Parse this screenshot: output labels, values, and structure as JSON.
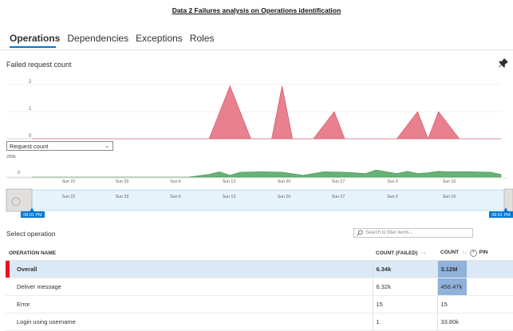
{
  "document": {
    "title": "Data 2 Failures analysis on Operations identification"
  },
  "tabs": [
    {
      "label": "Operations",
      "active": true
    },
    {
      "label": "Dependencies"
    },
    {
      "label": "Exceptions"
    },
    {
      "label": "Roles"
    }
  ],
  "failed_chart": {
    "title": "Failed request count",
    "pin_icon": "pin-icon"
  },
  "metric_select": {
    "value": "Request count"
  },
  "chart_data": [
    {
      "type": "area",
      "title": "Failed request count",
      "ylim": [
        0,
        2
      ],
      "yticks": [
        "2",
        "1",
        "0"
      ],
      "x_day_index": [
        0,
        17,
        19,
        21,
        23,
        24,
        25,
        27,
        29,
        30,
        31,
        35,
        37,
        38,
        39,
        41,
        43,
        45
      ],
      "values": [
        0,
        0,
        1.95,
        0,
        0,
        1.95,
        0,
        0,
        1.0,
        0,
        0,
        0,
        1.0,
        0,
        1.0,
        0,
        0,
        0
      ],
      "xlim_days": [
        0,
        45
      ],
      "color": "#e8808e"
    },
    {
      "type": "area",
      "title": "Request count",
      "yticks": [
        "200k",
        "0"
      ],
      "ylim": [
        0,
        200
      ],
      "x_day_index": [
        0,
        3,
        6,
        9,
        12,
        15,
        17,
        18,
        19,
        20,
        22,
        24,
        26,
        28,
        30,
        32,
        33,
        35,
        36,
        37,
        38,
        39,
        40,
        42,
        44,
        45
      ],
      "values": [
        0,
        0,
        0,
        0,
        0,
        0,
        30,
        60,
        20,
        55,
        60,
        55,
        20,
        60,
        55,
        40,
        80,
        40,
        65,
        40,
        50,
        65,
        60,
        60,
        55,
        30
      ],
      "color": "#66b376",
      "xtick_labels": [
        "Sun 22",
        "Sun 29",
        "Sun 6",
        "Sun 13",
        "Sun 20",
        "Sun 27",
        "Sun 3",
        "Sun 10"
      ]
    }
  ],
  "time_brush": {
    "left_label": "08:01 PM",
    "right_label": "08:01 PM"
  },
  "operations": {
    "title": "Select operation",
    "filter_placeholder": "Search to filter items...",
    "columns": {
      "name": "OPERATION NAME",
      "failed": "COUNT (FAILED)",
      "count": "COUNT",
      "pin": "PIN"
    },
    "rows": [
      {
        "name": "Overall",
        "failed": "6.34k",
        "count": "3.12M",
        "count_fraction": 1.0
      },
      {
        "name": "Deliver message",
        "failed": "6.32k",
        "count": "456.47k",
        "count_fraction": 1.0
      },
      {
        "name": "Error",
        "failed": "15",
        "count": "15",
        "count_fraction": 0
      },
      {
        "name": "Login using username",
        "failed": "1",
        "count": "33.80k",
        "count_fraction": 0
      }
    ]
  }
}
